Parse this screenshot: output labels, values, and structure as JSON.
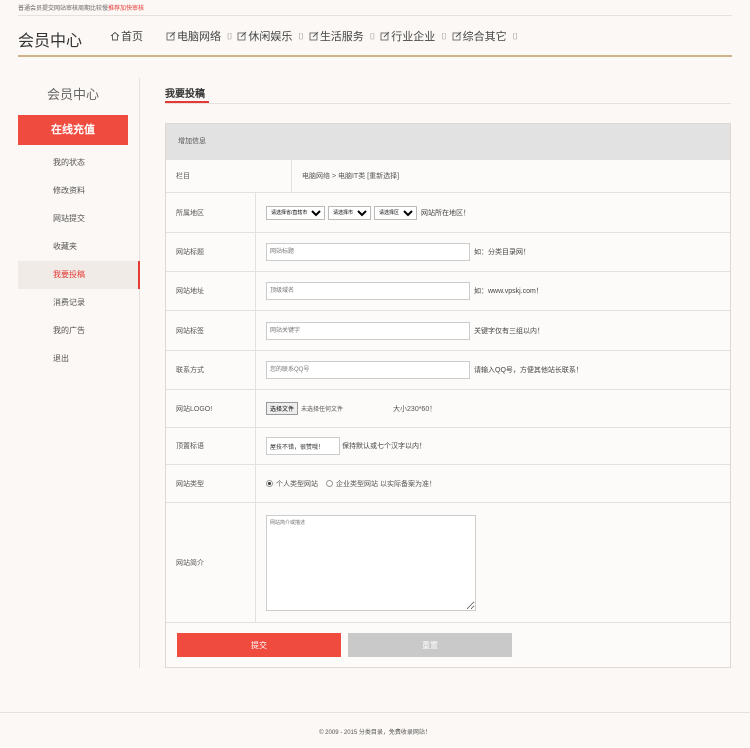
{
  "topbar": {
    "notice": "普通会员提交网站审核周期比较慢",
    "link": "推荐加快审核"
  },
  "header": {
    "logo": "会员中心",
    "nav": [
      {
        "label": "首页",
        "icon": "home-icon"
      },
      {
        "label": "电脑网络",
        "icon": "edit-icon"
      },
      {
        "label": "休闲娱乐",
        "icon": "edit-icon"
      },
      {
        "label": "生活服务",
        "icon": "edit-icon"
      },
      {
        "label": "行业企业",
        "icon": "edit-icon"
      },
      {
        "label": "综合其它",
        "icon": "edit-icon"
      }
    ]
  },
  "sidebar": {
    "title": "会员中心",
    "charge_button": "在线充值",
    "items": [
      "我的状态",
      "修改资料",
      "网站提交",
      "收藏夹",
      "我要投稿",
      "消费记录",
      "我的广告",
      "退出"
    ],
    "active_item": "我要投稿"
  },
  "main": {
    "title": "我要投稿",
    "form_head": "增加信息",
    "fields": {
      "column": {
        "label": "栏目",
        "value": "电脑网络 > 电脑IT类 [重新选择]"
      },
      "region": {
        "label": "所属地区",
        "select1": "请选择省/直辖市",
        "select2": "请选择市",
        "select3": "请选择区",
        "hint": "网站所在地区！"
      },
      "site_title": {
        "label": "网站标题",
        "placeholder": "网站标题",
        "hint": "如：分类目录网！"
      },
      "site_url": {
        "label": "网站地址",
        "placeholder": "顶级域名",
        "hint": "如：www.vpskj.com！"
      },
      "site_tags": {
        "label": "网站标签",
        "placeholder": "网站关键字",
        "hint": "关键字仅有三组以内！"
      },
      "contact": {
        "label": "联系方式",
        "placeholder": "您的联系QQ号",
        "hint": "请输入QQ号，方便其他站长联系！"
      },
      "logo": {
        "label": "网站LOGO!",
        "button": "选择文件",
        "status": "未选择任何文件",
        "size_hint": "大小230*60！"
      },
      "pin": {
        "label": "顶置标语",
        "value": "屋技不错，很赞哦！",
        "hint": "保持默认或七个汉字以内！"
      },
      "site_type": {
        "label": "网站类型",
        "option1": "个人类型网站",
        "option2": "企业类型网站 以实际备案为准！"
      },
      "intro": {
        "label": "网站简介",
        "placeholder": "网站简介或描述"
      }
    },
    "submit": "提交",
    "reset": "重置"
  },
  "footer": {
    "text": "© 2009 - 2015 分类目录，免费收录网站！"
  },
  "colors": {
    "accent": "#ef4b3f",
    "nav_line": "#cfb28a",
    "background": "#fbf8f5"
  }
}
